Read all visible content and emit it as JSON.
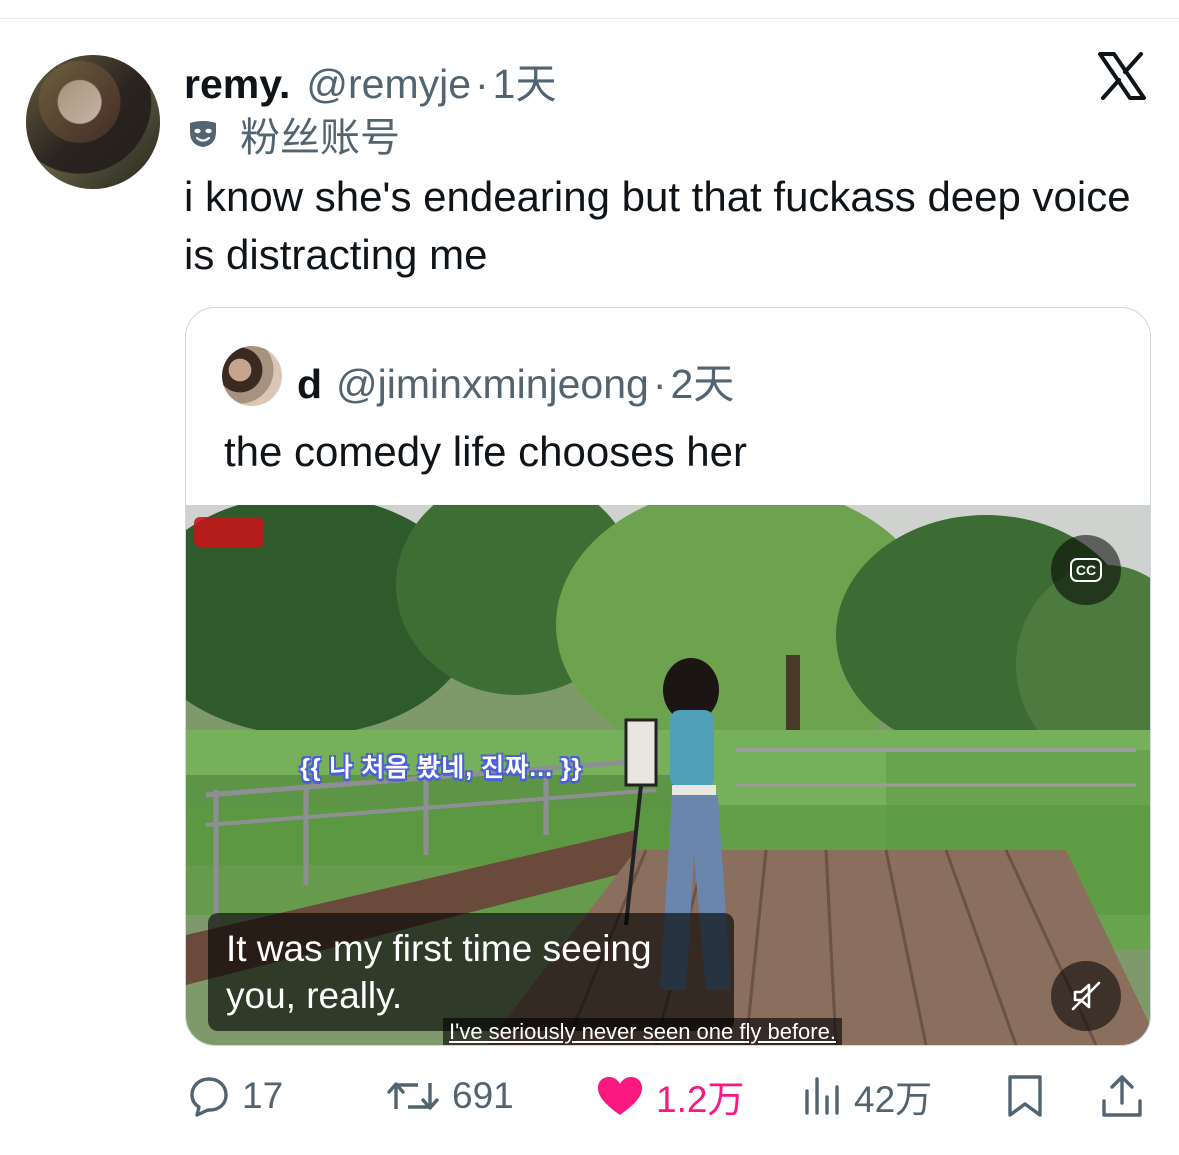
{
  "tweet": {
    "display_name": "remy.",
    "handle": "@remyje",
    "dot": "·",
    "time": "1天",
    "fan_label": "粉丝账号",
    "text": "i know she's endearing but that fuckass deep voice is distracting me",
    "platform_icon": "x-logo-icon",
    "fan_icon": "mask-icon"
  },
  "quoted": {
    "display_name": "d",
    "handle": "@jiminxminjeong",
    "dot": "·",
    "time": "2天",
    "text": "the comedy life chooses her",
    "video": {
      "korean_subtitle": "{{ 나 처음 봤네, 진짜... }}",
      "caption": "It was my first time seeing you, really.",
      "burned_subtitle": "I've seriously never seen one fly before.",
      "cc_label": "CC",
      "cc_icon": "closed-captions-icon",
      "mute_icon": "muted-speaker-icon"
    }
  },
  "actions": {
    "replies": "17",
    "reposts": "691",
    "likes": "1.2万",
    "views": "42万",
    "reply_icon": "reply-icon",
    "repost_icon": "repost-icon",
    "like_icon": "heart-icon",
    "views_icon": "views-icon",
    "bookmark_icon": "bookmark-icon",
    "share_icon": "share-icon"
  },
  "colors": {
    "text_primary": "#0f1419",
    "text_secondary": "#536471",
    "like_pink": "#f91880",
    "border": "#cfd9de"
  }
}
